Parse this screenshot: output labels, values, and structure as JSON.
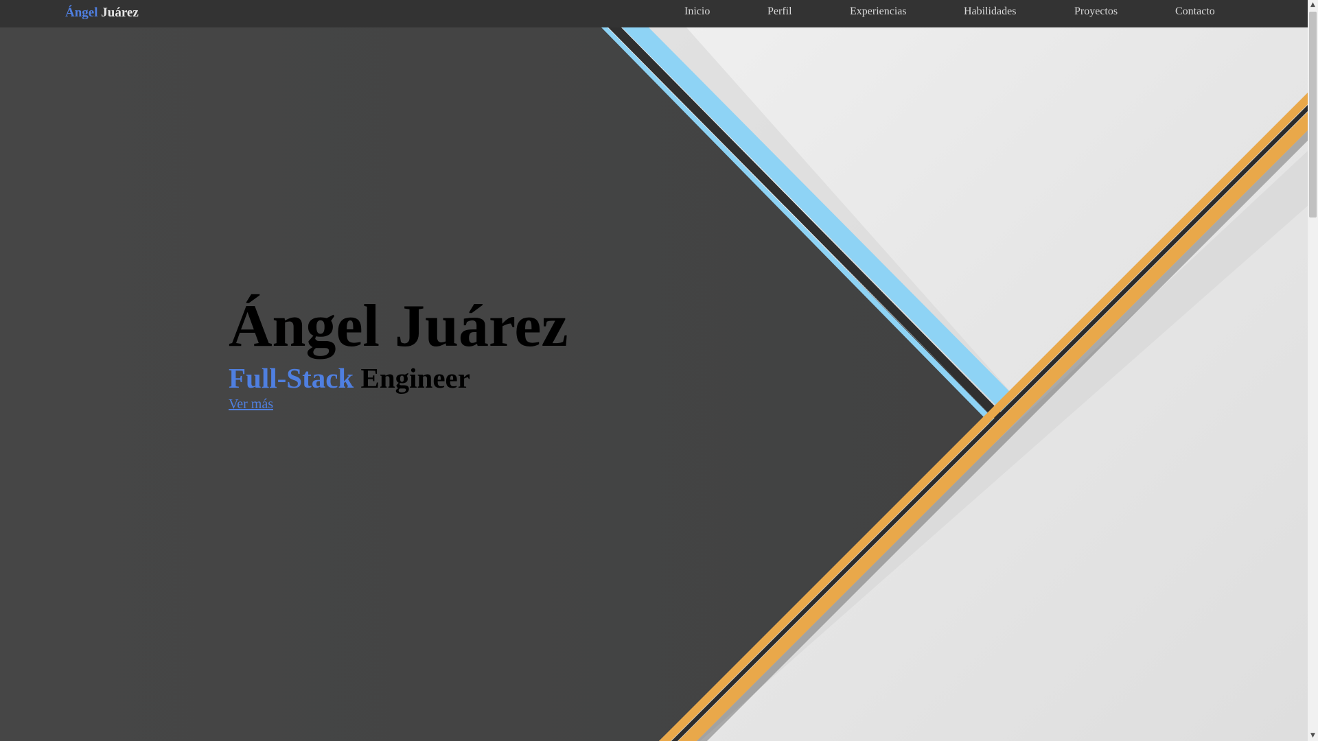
{
  "header": {
    "brand_first": "Ángel",
    "brand_last": "Juárez",
    "nav": [
      {
        "label": "Inicio"
      },
      {
        "label": "Perfil"
      },
      {
        "label": "Experiencias"
      },
      {
        "label": "Habilidades"
      },
      {
        "label": "Proyectos"
      },
      {
        "label": "Contacto"
      }
    ]
  },
  "hero": {
    "name": "Ángel Juárez",
    "role_accent": "Full-Stack",
    "role_rest": "Engineer",
    "cta": "Ver más"
  },
  "colors": {
    "accent": "#4f7fe0",
    "navbar": "#333333",
    "background_dark": "#444545",
    "background_light": "#e8e8e8",
    "stripe_blue": "#8ed3f5",
    "stripe_orange": "#e9a84a"
  },
  "icons": {
    "scroll_up": "chevron-up-icon",
    "scroll_down": "chevron-down-icon"
  }
}
